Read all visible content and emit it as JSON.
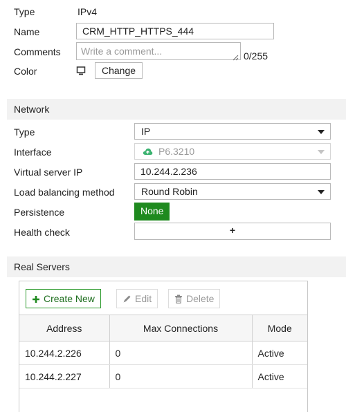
{
  "general": {
    "type_label": "Type",
    "type_value": "IPv4",
    "name_label": "Name",
    "name_value": "CRM_HTTP_HTTPS_444",
    "comments_label": "Comments",
    "comments_placeholder": "Write a comment...",
    "comments_counter": "0/255",
    "color_label": "Color",
    "change_label": "Change"
  },
  "network": {
    "section_title": "Network",
    "type_label": "Type",
    "type_value": "IP",
    "interface_label": "Interface",
    "interface_value": "P6.3210",
    "vip_label": "Virtual server IP",
    "vip_value": "10.244.2.236",
    "lb_label": "Load balancing method",
    "lb_value": "Round Robin",
    "persistence_label": "Persistence",
    "persistence_value": "None",
    "health_label": "Health check",
    "health_add": "+"
  },
  "real_servers": {
    "section_title": "Real Servers",
    "create_label": "Create New",
    "edit_label": "Edit",
    "delete_label": "Delete",
    "columns": [
      "Address",
      "Max Connections",
      "Mode"
    ],
    "rows": [
      [
        "10.244.2.226",
        "0",
        "Active"
      ],
      [
        "10.244.2.227",
        "0",
        "Active"
      ]
    ]
  },
  "colors": {
    "accent_green": "#1f8a1f",
    "cloud_green": "#3cb371"
  },
  "icons": [
    "monitor-icon",
    "cloud-icon",
    "plus-icon",
    "pencil-icon",
    "trash-icon",
    "chevron-down-icon",
    "resize-grip-icon"
  ]
}
